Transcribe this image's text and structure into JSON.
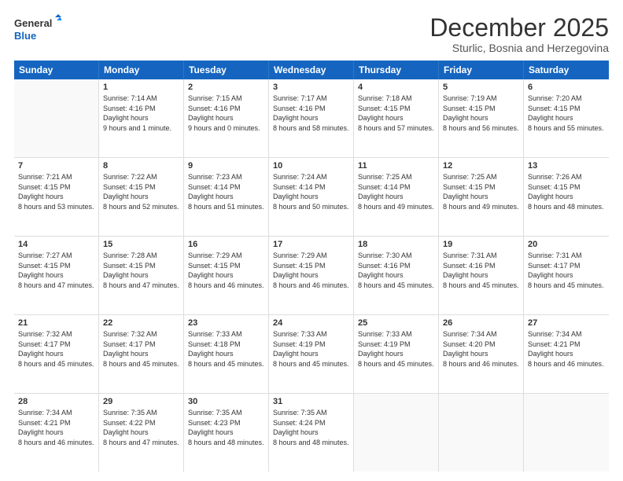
{
  "logo": {
    "line1": "General",
    "line2": "Blue"
  },
  "header": {
    "month": "December 2025",
    "location": "Sturlic, Bosnia and Herzegovina"
  },
  "weekdays": [
    "Sunday",
    "Monday",
    "Tuesday",
    "Wednesday",
    "Thursday",
    "Friday",
    "Saturday"
  ],
  "rows": [
    [
      {
        "day": "",
        "empty": true
      },
      {
        "day": "1",
        "sunrise": "7:14 AM",
        "sunset": "4:16 PM",
        "daylight": "9 hours and 1 minute."
      },
      {
        "day": "2",
        "sunrise": "7:15 AM",
        "sunset": "4:16 PM",
        "daylight": "9 hours and 0 minutes."
      },
      {
        "day": "3",
        "sunrise": "7:17 AM",
        "sunset": "4:16 PM",
        "daylight": "8 hours and 58 minutes."
      },
      {
        "day": "4",
        "sunrise": "7:18 AM",
        "sunset": "4:15 PM",
        "daylight": "8 hours and 57 minutes."
      },
      {
        "day": "5",
        "sunrise": "7:19 AM",
        "sunset": "4:15 PM",
        "daylight": "8 hours and 56 minutes."
      },
      {
        "day": "6",
        "sunrise": "7:20 AM",
        "sunset": "4:15 PM",
        "daylight": "8 hours and 55 minutes."
      }
    ],
    [
      {
        "day": "7",
        "sunrise": "7:21 AM",
        "sunset": "4:15 PM",
        "daylight": "8 hours and 53 minutes."
      },
      {
        "day": "8",
        "sunrise": "7:22 AM",
        "sunset": "4:15 PM",
        "daylight": "8 hours and 52 minutes."
      },
      {
        "day": "9",
        "sunrise": "7:23 AM",
        "sunset": "4:14 PM",
        "daylight": "8 hours and 51 minutes."
      },
      {
        "day": "10",
        "sunrise": "7:24 AM",
        "sunset": "4:14 PM",
        "daylight": "8 hours and 50 minutes."
      },
      {
        "day": "11",
        "sunrise": "7:25 AM",
        "sunset": "4:14 PM",
        "daylight": "8 hours and 49 minutes."
      },
      {
        "day": "12",
        "sunrise": "7:25 AM",
        "sunset": "4:15 PM",
        "daylight": "8 hours and 49 minutes."
      },
      {
        "day": "13",
        "sunrise": "7:26 AM",
        "sunset": "4:15 PM",
        "daylight": "8 hours and 48 minutes."
      }
    ],
    [
      {
        "day": "14",
        "sunrise": "7:27 AM",
        "sunset": "4:15 PM",
        "daylight": "8 hours and 47 minutes."
      },
      {
        "day": "15",
        "sunrise": "7:28 AM",
        "sunset": "4:15 PM",
        "daylight": "8 hours and 47 minutes."
      },
      {
        "day": "16",
        "sunrise": "7:29 AM",
        "sunset": "4:15 PM",
        "daylight": "8 hours and 46 minutes."
      },
      {
        "day": "17",
        "sunrise": "7:29 AM",
        "sunset": "4:15 PM",
        "daylight": "8 hours and 46 minutes."
      },
      {
        "day": "18",
        "sunrise": "7:30 AM",
        "sunset": "4:16 PM",
        "daylight": "8 hours and 45 minutes."
      },
      {
        "day": "19",
        "sunrise": "7:31 AM",
        "sunset": "4:16 PM",
        "daylight": "8 hours and 45 minutes."
      },
      {
        "day": "20",
        "sunrise": "7:31 AM",
        "sunset": "4:17 PM",
        "daylight": "8 hours and 45 minutes."
      }
    ],
    [
      {
        "day": "21",
        "sunrise": "7:32 AM",
        "sunset": "4:17 PM",
        "daylight": "8 hours and 45 minutes."
      },
      {
        "day": "22",
        "sunrise": "7:32 AM",
        "sunset": "4:17 PM",
        "daylight": "8 hours and 45 minutes."
      },
      {
        "day": "23",
        "sunrise": "7:33 AM",
        "sunset": "4:18 PM",
        "daylight": "8 hours and 45 minutes."
      },
      {
        "day": "24",
        "sunrise": "7:33 AM",
        "sunset": "4:19 PM",
        "daylight": "8 hours and 45 minutes."
      },
      {
        "day": "25",
        "sunrise": "7:33 AM",
        "sunset": "4:19 PM",
        "daylight": "8 hours and 45 minutes."
      },
      {
        "day": "26",
        "sunrise": "7:34 AM",
        "sunset": "4:20 PM",
        "daylight": "8 hours and 46 minutes."
      },
      {
        "day": "27",
        "sunrise": "7:34 AM",
        "sunset": "4:21 PM",
        "daylight": "8 hours and 46 minutes."
      }
    ],
    [
      {
        "day": "28",
        "sunrise": "7:34 AM",
        "sunset": "4:21 PM",
        "daylight": "8 hours and 46 minutes."
      },
      {
        "day": "29",
        "sunrise": "7:35 AM",
        "sunset": "4:22 PM",
        "daylight": "8 hours and 47 minutes."
      },
      {
        "day": "30",
        "sunrise": "7:35 AM",
        "sunset": "4:23 PM",
        "daylight": "8 hours and 48 minutes."
      },
      {
        "day": "31",
        "sunrise": "7:35 AM",
        "sunset": "4:24 PM",
        "daylight": "8 hours and 48 minutes."
      },
      {
        "day": "",
        "empty": true
      },
      {
        "day": "",
        "empty": true
      },
      {
        "day": "",
        "empty": true
      }
    ]
  ]
}
